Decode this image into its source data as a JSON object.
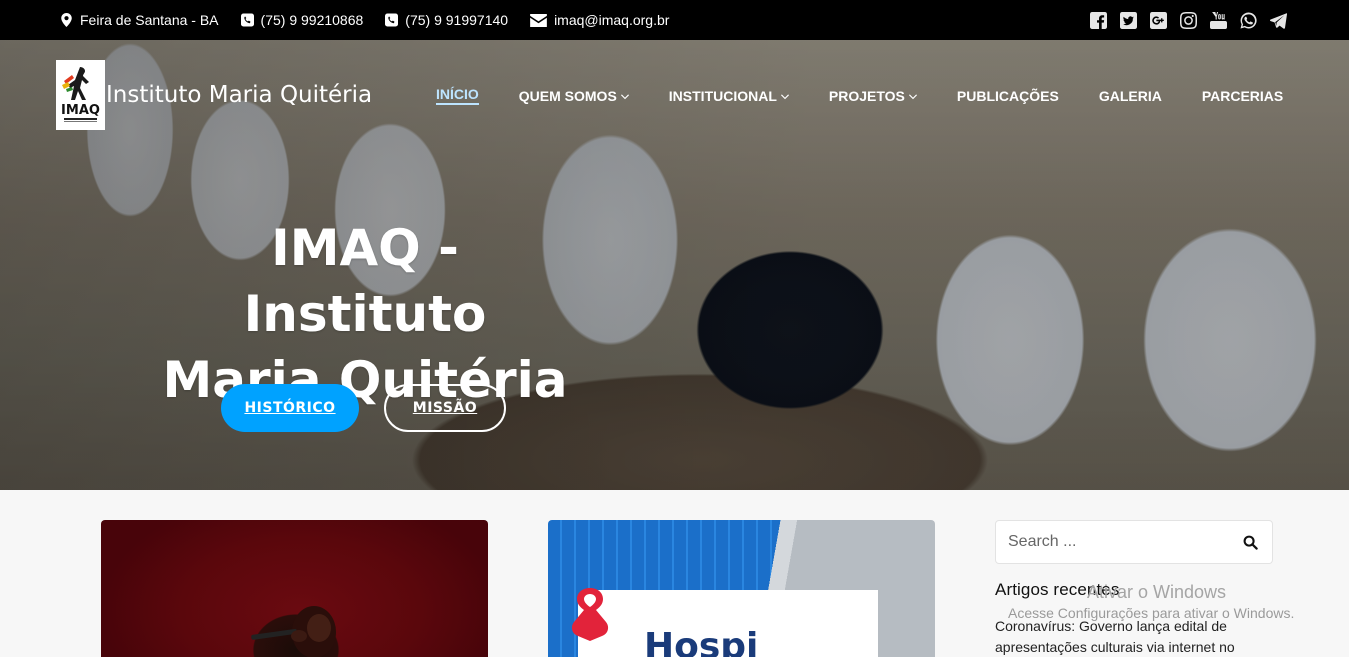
{
  "topbar": {
    "location": "Feira de Santana - BA",
    "phone1": "(75) 9 99210868",
    "phone2": "(75) 9 91997140",
    "email": "imaq@imaq.org.br",
    "social_icons": [
      "facebook-icon",
      "twitter-icon",
      "google-plus-icon",
      "instagram-icon",
      "youtube-icon",
      "whatsapp-icon",
      "telegram-icon"
    ]
  },
  "site": {
    "title": "Instituto Maria Quitéria",
    "logo_text": "IMAQ"
  },
  "nav": {
    "items": [
      {
        "label": "INÍCIO",
        "active": true,
        "dropdown": false
      },
      {
        "label": "QUEM SOMOS",
        "active": false,
        "dropdown": true
      },
      {
        "label": "INSTITUCIONAL",
        "active": false,
        "dropdown": true
      },
      {
        "label": "PROJETOS",
        "active": false,
        "dropdown": true
      },
      {
        "label": "PUBLICAÇÕES",
        "active": false,
        "dropdown": false
      },
      {
        "label": "GALERIA",
        "active": false,
        "dropdown": false
      },
      {
        "label": "PARCERIAS",
        "active": false,
        "dropdown": false
      }
    ]
  },
  "hero": {
    "title_line1": "IMAQ - Instituto",
    "title_line2": "Maria Quitéria",
    "button_primary": "HISTÓRICO",
    "button_secondary": "MISSÃO"
  },
  "cards": {
    "card2_sign_text": "Hospi"
  },
  "sidebar": {
    "search_placeholder": "Search ...",
    "recent_title": "Artigos recentes",
    "recent_posts": [
      "Coronavírus: Governo lança edital de apresentações culturais via internet no"
    ]
  },
  "overlay": {
    "watermark_title": "Ativar o Windows",
    "watermark_text": "Acesse Configurações para ativar o Windows."
  },
  "colors": {
    "accent": "#00a2ff",
    "topbar": "#000000",
    "nav_active": "#bde4ff"
  }
}
